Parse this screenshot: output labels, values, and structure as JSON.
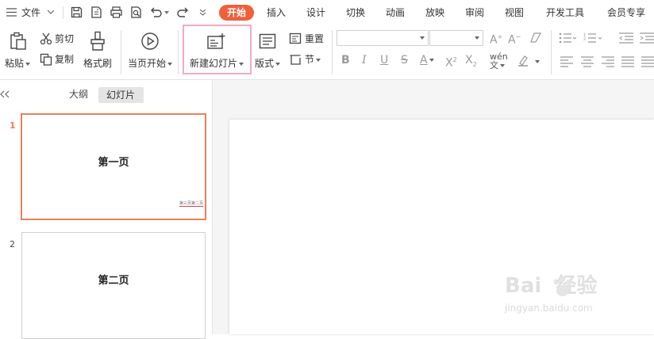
{
  "menubar": {
    "file_label": "文件",
    "tabs": [
      {
        "label": "开始",
        "active": true
      },
      {
        "label": "插入"
      },
      {
        "label": "设计"
      },
      {
        "label": "切换"
      },
      {
        "label": "动画"
      },
      {
        "label": "放映"
      },
      {
        "label": "审阅"
      },
      {
        "label": "视图"
      },
      {
        "label": "开发工具"
      },
      {
        "label": "会员专享"
      }
    ],
    "active_color": "#f0603a"
  },
  "ribbon": {
    "paste_label": "粘贴",
    "cut_label": "剪切",
    "copy_label": "复制",
    "format_painter_label": "格式刷",
    "play_current_label": "当页开始",
    "new_slide_label": "新建幻灯片",
    "layout_label": "版式",
    "reset_label": "重置",
    "section_label": "节",
    "highlight_color": "#f4a9c4"
  },
  "panel": {
    "tab_outline": "大纲",
    "tab_slides": "幻灯片",
    "slides": [
      {
        "number": "1",
        "title": "第一页",
        "footer": "第三页第二页",
        "selected": true
      },
      {
        "number": "2",
        "title": "第二页",
        "selected": false
      }
    ],
    "selected_border_color": "#e8825a"
  },
  "watermark": {
    "brand": "Bai  经验",
    "url": "jingyan.baidu.com"
  }
}
